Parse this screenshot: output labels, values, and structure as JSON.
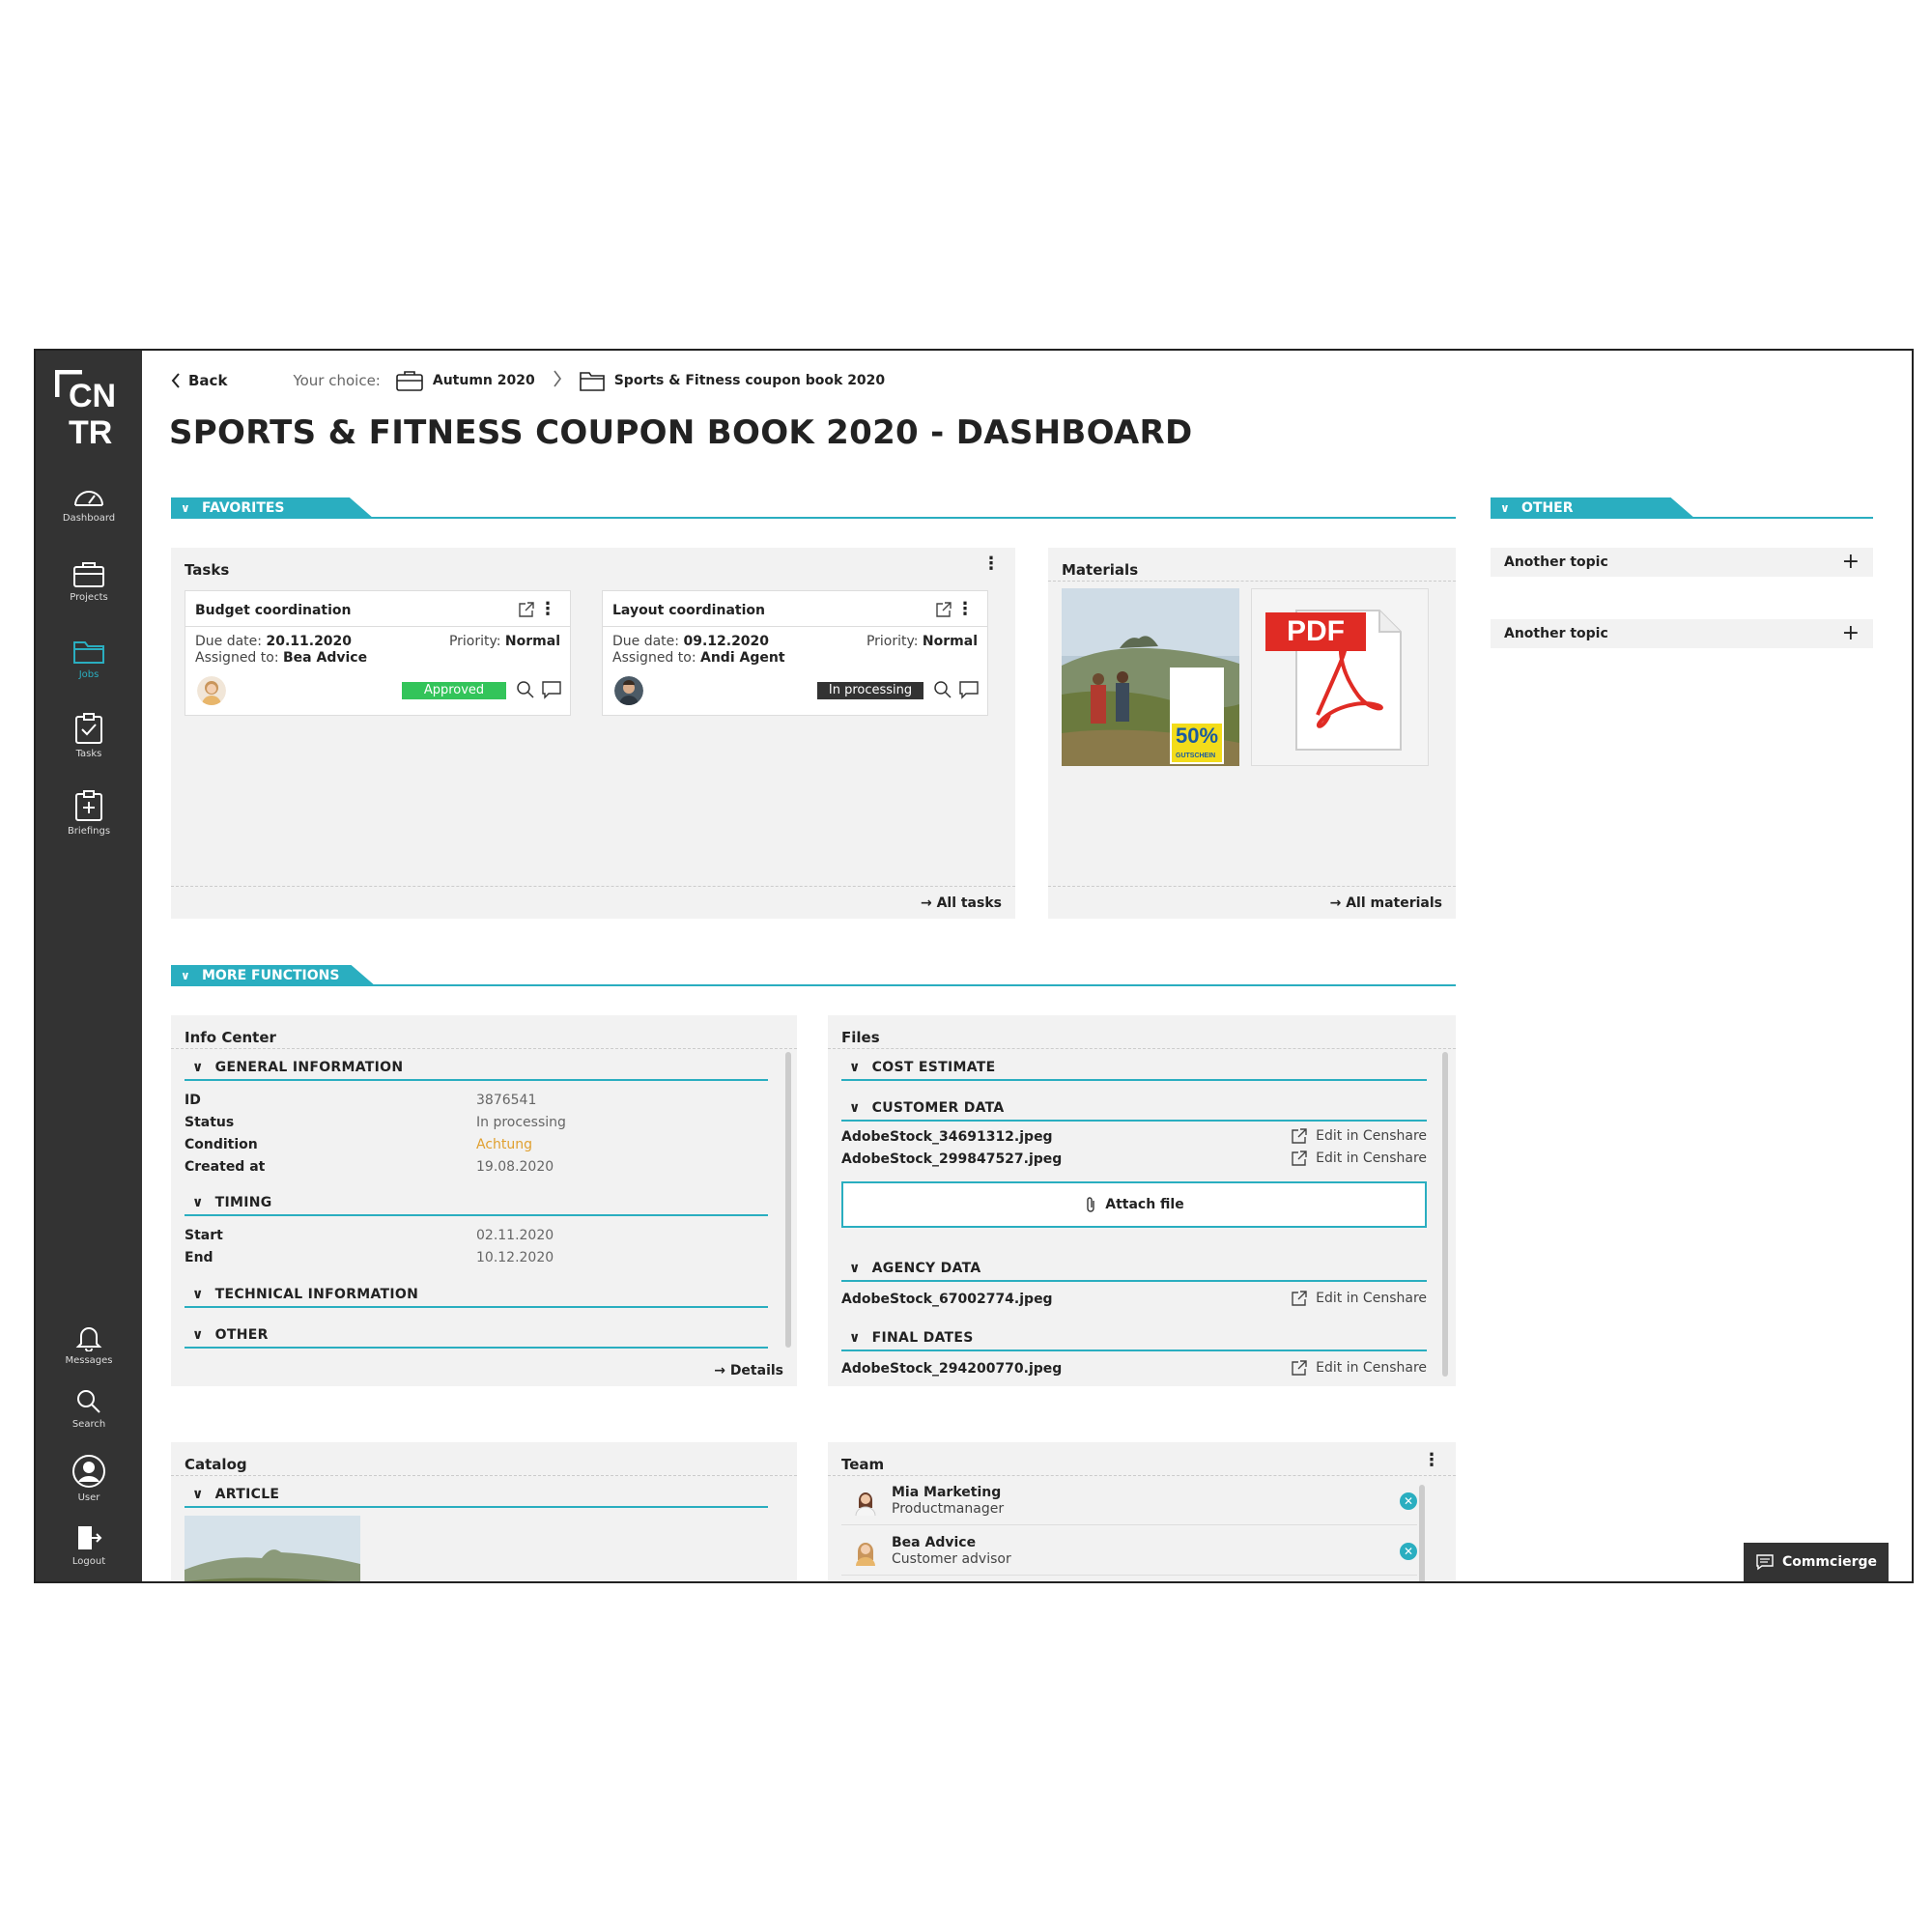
{
  "brand": {
    "logo_line1": "CN",
    "logo_line2": "TR"
  },
  "sidebar": {
    "items": [
      {
        "label": "Dashboard",
        "icon": "dashboard-icon"
      },
      {
        "label": "Projects",
        "icon": "briefcase-icon"
      },
      {
        "label": "Jobs",
        "icon": "folder-icon",
        "active": true
      },
      {
        "label": "Tasks",
        "icon": "tasks-icon"
      },
      {
        "label": "Briefings",
        "icon": "briefing-icon"
      }
    ],
    "bottom": [
      {
        "label": "Messages",
        "icon": "bell-icon"
      },
      {
        "label": "Search",
        "icon": "search-icon"
      },
      {
        "label": "User",
        "icon": "user-icon"
      },
      {
        "label": "Logout",
        "icon": "logout-icon"
      }
    ]
  },
  "breadcrumb": {
    "back": "Back",
    "your_choice": "Your choice:",
    "project": "Autumn 2020",
    "job": "Sports & Fitness coupon book 2020"
  },
  "page_title": "SPORTS & FITNESS COUPON BOOK 2020 - DASHBOARD",
  "favorites": {
    "label": "FAVORITES"
  },
  "other_section": {
    "label": "OTHER",
    "topics": [
      "Another topic",
      "Another topic"
    ]
  },
  "tasks": {
    "title": "Tasks",
    "all_link": "All tasks",
    "cards": [
      {
        "title": "Budget coordination",
        "due_label": "Due date:",
        "due": "20.11.2020",
        "assigned_label": "Assigned to:",
        "assignee": "Bea Advice",
        "priority_label": "Priority:",
        "priority": "Normal",
        "status": "Approved",
        "status_color": "#33c45a"
      },
      {
        "title": "Layout coordination",
        "due_label": "Due date:",
        "due": "09.12.2020",
        "assigned_label": "Assigned to:",
        "assignee": "Andi Agent",
        "priority_label": "Priority:",
        "priority": "Normal",
        "status": "In processing",
        "status_color": "#333333"
      }
    ]
  },
  "materials": {
    "title": "Materials",
    "all_link": "All materials",
    "pdf_label": "PDF",
    "coupon_text": "50%",
    "coupon_sub": "GUTSCHEIN"
  },
  "more_functions": {
    "label": "MORE FUNCTIONS"
  },
  "info_center": {
    "title": "Info Center",
    "general": "GENERAL INFORMATION",
    "rows": [
      {
        "k": "ID",
        "v": "3876541"
      },
      {
        "k": "Status",
        "v": "In processing"
      },
      {
        "k": "Condition",
        "v": "Achtung"
      },
      {
        "k": "Created at",
        "v": "19.08.2020"
      }
    ],
    "timing": "TIMING",
    "timing_rows": [
      {
        "k": "Start",
        "v": "02.11.2020"
      },
      {
        "k": "End",
        "v": "10.12.2020"
      }
    ],
    "technical": "TECHNICAL INFORMATION",
    "other": "OTHER",
    "details_link": "Details"
  },
  "files": {
    "title": "Files",
    "cost_estimate": "COST ESTIMATE",
    "customer_data": "CUSTOMER DATA",
    "customer_files": [
      "AdobeStock_34691312.jpeg",
      "AdobeStock_299847527.jpeg"
    ],
    "edit_label": "Edit in Censhare",
    "attach": "Attach file",
    "agency_data": "AGENCY DATA",
    "agency_files": [
      "AdobeStock_67002774.jpeg"
    ],
    "final_dates": "FINAL DATES",
    "final_files": [
      "AdobeStock_294200770.jpeg"
    ]
  },
  "catalog": {
    "title": "Catalog",
    "article": "ARTICLE"
  },
  "team": {
    "title": "Team",
    "members": [
      {
        "name": "Mia Marketing",
        "role": "Productmanager"
      },
      {
        "name": "Bea Advice",
        "role": "Customer advisor"
      }
    ]
  },
  "commcierge": "Commcierge",
  "colors": {
    "accent": "#2aaec0",
    "sidebar": "#333333",
    "warning": "#e0a030"
  }
}
